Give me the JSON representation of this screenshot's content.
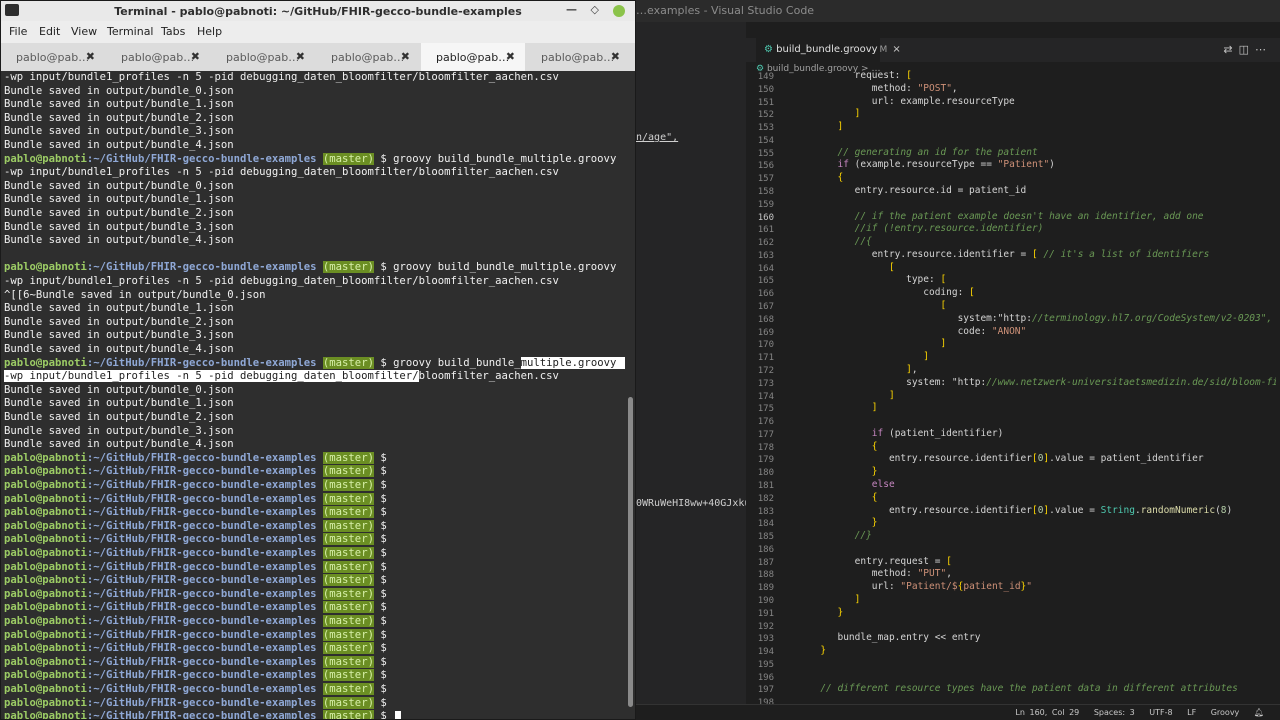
{
  "vscode": {
    "title": "…examples - Visual Studio Code",
    "tab": {
      "label": "build_bundle.groovy",
      "modified": "M",
      "close": "×"
    },
    "breadcrumb": "build_bundle.groovy > …",
    "side_fragments": [
      "n/age\",",
      "0WRuWeHI8ww+40GJxkuA"
    ],
    "status": {
      "position": "Ln 160, Col 29",
      "spaces": "Spaces: 3",
      "encoding": "UTF-8",
      "eol": "LF",
      "language": "Groovy"
    },
    "line_numbers": [
      "149",
      "150",
      "151",
      "152",
      "153",
      "154",
      "155",
      "156",
      "157",
      "158",
      "159",
      "160",
      "161",
      "162",
      "163",
      "164",
      "165",
      "166",
      "167",
      "168",
      "169",
      "170",
      "171",
      "172",
      "173",
      "174",
      "175",
      "176",
      "177",
      "178",
      "179",
      "180",
      "181",
      "182",
      "183",
      "184",
      "185",
      "186",
      "187",
      "188",
      "189",
      "190",
      "191",
      "192",
      "193",
      "194",
      "195",
      "196",
      "197",
      "198"
    ],
    "code": [
      "            request: [",
      "               method: \"POST\",",
      "               url: example.resourceType",
      "            ]",
      "         ]",
      "",
      "         // generating an id for the patient",
      "         if (example.resourceType == \"Patient\")",
      "         {",
      "            entry.resource.id = patient_id",
      "",
      "            // if the patient example doesn't have an identifier, add one",
      "            //if (!entry.resource.identifier)",
      "            //{",
      "               entry.resource.identifier = [ // it's a list of identifiers",
      "                  [",
      "                     type: [",
      "                        coding: [",
      "                           [",
      "                              system:\"http://terminology.hl7.org/CodeSystem/v2-0203\",",
      "                              code: \"ANON\"",
      "                           ]",
      "                        ]",
      "                     ],",
      "                     system: \"http://www.netzwerk-universitaetsmedizin.de/sid/bloom-filter\"",
      "                  ]",
      "               ]",
      "",
      "               if (patient_identifier)",
      "               {",
      "                  entry.resource.identifier[0].value = patient_identifier",
      "               }",
      "               else",
      "               {",
      "                  entry.resource.identifier[0].value = String.randomNumeric(8)",
      "               }",
      "            //}",
      "",
      "            entry.request = [",
      "               method: \"PUT\",",
      "               url: \"Patient/${patient_id}\"",
      "            ]",
      "         }",
      "",
      "         bundle_map.entry << entry",
      "      }",
      "",
      "",
      "      // different resource types have the patient data in different attributes"
    ]
  },
  "terminal": {
    "title": "Terminal - pablo@pabnoti: ~/GitHub/FHIR-gecco-bundle-examples",
    "menu": [
      "File",
      "Edit",
      "View",
      "Terminal",
      "Tabs",
      "Help"
    ],
    "tabs": [
      "pablo@pab…",
      "pablo@pab…",
      "pablo@pab…",
      "pablo@pab…",
      "pablo@pab…",
      "pablo@pab…"
    ],
    "tab_close": "✖",
    "prompt": {
      "user": "pablo@pabnoti",
      "path": ":~/GitHub/FHIR-gecco-bundle-examples",
      "branch": "(master)",
      "symbol": "$"
    },
    "command": "groovy build_bundle_multiple.groovy",
    "args_line": "-wp input/bundle1_profiles -n 5 -pid debugging_daten_bloomfilter/bloomfilter_aachen.csv",
    "saved": [
      "Bundle saved in output/bundle_0.json",
      "Bundle saved in output/bundle_1.json",
      "Bundle saved in output/bundle_2.json",
      "Bundle saved in output/bundle_3.json",
      "Bundle saved in output/bundle_4.json"
    ],
    "garbled": "^[[6~Bundle saved in output/bundle_0.json"
  }
}
